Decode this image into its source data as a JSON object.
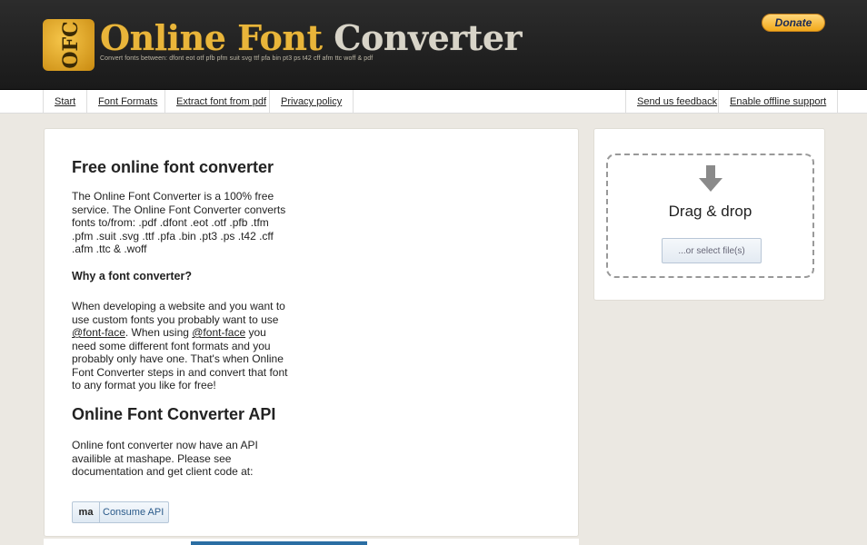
{
  "header": {
    "logo_badge": "OFC",
    "title_part1": "Online Font",
    "title_part2": "Converter",
    "subtitle": "Convert fonts between: dfont eot otf pfb pfm suit svg ttf pfa bin pt3 ps t42 cff afm ttc woff & pdf",
    "donate_label": "Donate"
  },
  "nav": {
    "left": [
      "Start",
      "Font Formats",
      "Extract font from pdf",
      "Privacy policy"
    ],
    "right": [
      "Send us feedback",
      "Enable offline support"
    ]
  },
  "main": {
    "title": "Free online font converter",
    "intro": "The Online Font Converter is a 100% free service. The Online Font Converter converts fonts to/from: .pdf .dfont .eot .otf .pfb .tfm .pfm .suit .svg .ttf .pfa .bin .pt3 .ps .t42 .cff .afm .ttc & .woff",
    "why_heading": "Why a font converter?",
    "why_text_1": "When developing a website and you want to use custom fonts you probably want to use ",
    "why_link_1": "@font-face",
    "why_text_2": ". When using ",
    "why_link_2": "@font-face",
    "why_text_3": " you need some different font formats and you probably only have one. That's when Online Font Converter steps in and convert that font to any format you like for free!",
    "api_heading": "Online Font Converter API",
    "api_text": "Online font converter now have an API availible at mashape. Please see documentation and get client code at:",
    "api_button_icon": "ma",
    "api_button_label": "Consume API"
  },
  "upload": {
    "drag_label": "Drag & drop",
    "select_label": "...or select file(s)",
    "icon": "down-arrow-icon"
  },
  "colors": {
    "header_bg": "#222222",
    "accent_gold": "#e9b53a",
    "page_bg": "#ebe8e2",
    "link_blue": "#2a5a8a"
  }
}
